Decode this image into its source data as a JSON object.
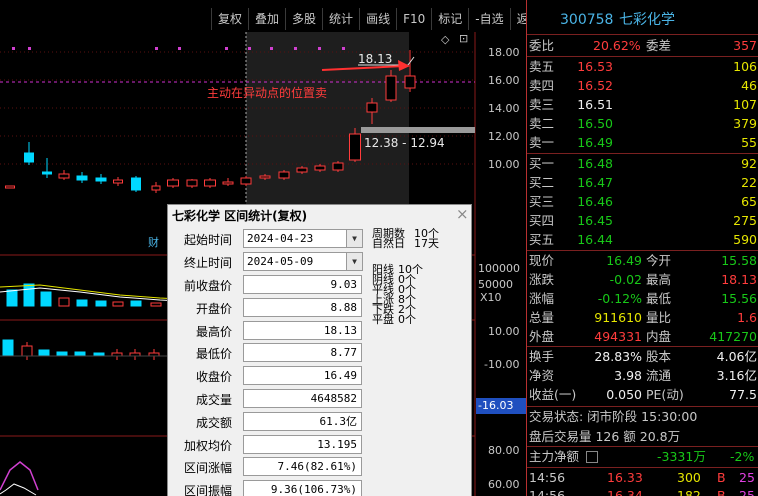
{
  "toolbar": {
    "items": [
      "复权",
      "叠加",
      "多股",
      "统计",
      "画线",
      "F10",
      "标记",
      "-自选",
      "返回"
    ]
  },
  "chart_area": {
    "price_axis": [
      "18.00",
      "16.00",
      "14.00",
      "12.00",
      "10.00"
    ],
    "volume_axis": [
      "100000",
      "50000",
      "X10"
    ],
    "indicator_axis": [
      "10.00",
      "-10.00",
      "-16.03"
    ],
    "bottom_axis": [
      "80.00",
      "60.00"
    ],
    "high_label": "18.13",
    "range_label": "12.38 - 12.94",
    "annotation": "主动在异动点的位置卖",
    "badge": "财",
    "corner_icons": [
      "◇",
      "⊡"
    ],
    "colors": {
      "up": "#ff3c3c",
      "down": "#00d8ff",
      "bg": "#000000"
    }
  },
  "quote_panel": {
    "code": "300758",
    "name": "七彩化学",
    "weibi_label": "委比",
    "weibi_value": "20.62%",
    "weicha_label": "委差",
    "weicha_value": "357",
    "asks": [
      {
        "label": "卖五",
        "price": "16.53",
        "vol": "106"
      },
      {
        "label": "卖四",
        "price": "16.52",
        "vol": "46"
      },
      {
        "label": "卖三",
        "price": "16.51",
        "vol": "107"
      },
      {
        "label": "卖二",
        "price": "16.50",
        "vol": "379"
      },
      {
        "label": "卖一",
        "price": "16.49",
        "vol": "55"
      }
    ],
    "bids": [
      {
        "label": "买一",
        "price": "16.48",
        "vol": "92"
      },
      {
        "label": "买二",
        "price": "16.47",
        "vol": "22"
      },
      {
        "label": "买三",
        "price": "16.46",
        "vol": "65"
      },
      {
        "label": "买四",
        "price": "16.45",
        "vol": "275"
      },
      {
        "label": "买五",
        "price": "16.44",
        "vol": "590"
      }
    ],
    "stats": [
      {
        "l1": "现价",
        "v1": "16.49",
        "l2": "今开",
        "v2": "15.58"
      },
      {
        "l1": "涨跌",
        "v1": "-0.02",
        "l2": "最高",
        "v2": "18.13"
      },
      {
        "l1": "涨幅",
        "v1": "-0.12%",
        "l2": "最低",
        "v2": "15.56"
      },
      {
        "l1": "总量",
        "v1": "911610",
        "l2": "量比",
        "v2": "1.6"
      },
      {
        "l1": "外盘",
        "v1": "494331",
        "l2": "内盘",
        "v2": "417270"
      }
    ],
    "fund": [
      {
        "l1": "换手",
        "v1": "28.83%",
        "l2": "股本",
        "v2": "4.06亿"
      },
      {
        "l1": "净资",
        "v1": "3.98",
        "l2": "流通",
        "v2": "3.16亿"
      },
      {
        "l1": "收益(一)",
        "v1": "0.050",
        "l2": "PE(动)",
        "v2": "77.5"
      }
    ],
    "trade_status": "交易状态: 闭市阶段 15:30:00",
    "after_hours": "盘后交易量 126 额 20.8万",
    "main_flow_label": "主力净额",
    "main_flow_value": "-3331万",
    "main_flow_pct": "-2%",
    "ticks": [
      {
        "time": "14:56",
        "price": "16.33",
        "vol": "300",
        "side": "B",
        "num": "25"
      },
      {
        "time": "14:56",
        "price": "16.34",
        "vol": "182",
        "side": "B",
        "num": "25"
      }
    ]
  },
  "dialog": {
    "title": "七彩化学 区间统计(复权)",
    "start_label": "起始时间",
    "start_value": "2024-04-23",
    "end_label": "终止时间",
    "end_value": "2024-05-09",
    "fields": [
      {
        "label": "前收盘价",
        "value": "9.03"
      },
      {
        "label": "开盘价",
        "value": "8.88"
      },
      {
        "label": "最高价",
        "value": "18.13"
      },
      {
        "label": "最低价",
        "value": "8.77"
      },
      {
        "label": "收盘价",
        "value": "16.49"
      },
      {
        "label": "成交量",
        "value": "4648582"
      },
      {
        "label": "成交额",
        "value": "61.3亿"
      },
      {
        "label": "加权均价",
        "value": "13.195"
      },
      {
        "label": "区间涨幅",
        "value": "7.46(82.61%)"
      },
      {
        "label": "区间振幅",
        "value": "9.36(106.73%)"
      }
    ],
    "period_lines": [
      {
        "label": "周期数",
        "value": "10个"
      },
      {
        "label": "自然日",
        "value": "17天"
      }
    ],
    "count_lines": [
      {
        "label": "阳线",
        "value": "10个"
      },
      {
        "label": "阴线",
        "value": "0个"
      },
      {
        "label": "平线",
        "value": "0个"
      },
      {
        "label": "上涨",
        "value": "8个"
      },
      {
        "label": "下跌",
        "value": "2个"
      },
      {
        "label": "平盘",
        "value": "0个"
      }
    ]
  }
}
